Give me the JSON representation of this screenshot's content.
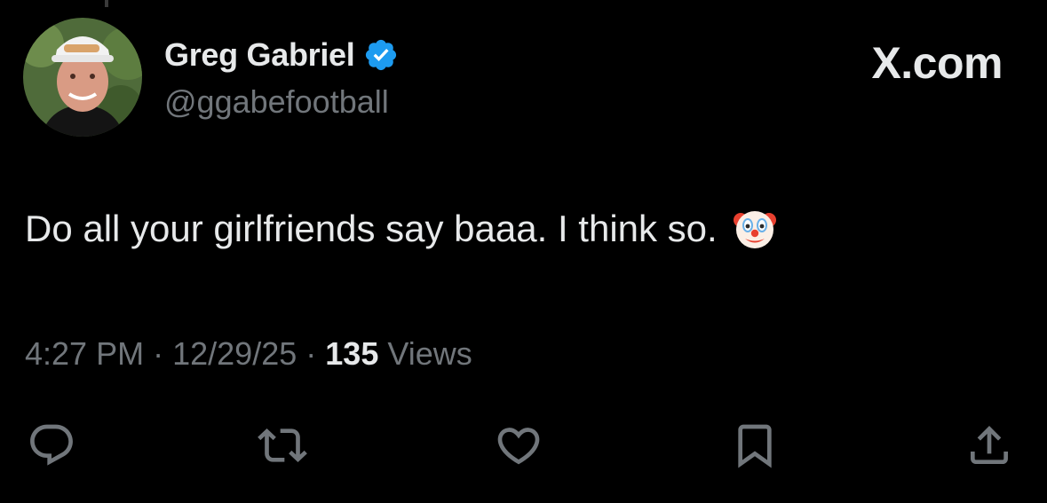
{
  "author": {
    "display_name": "Greg Gabriel",
    "handle": "@ggabefootball",
    "verified_badge_icon": "verified-check-icon",
    "verified_color": "#1d9bf0"
  },
  "brand": {
    "text": "X.com"
  },
  "tweet": {
    "text": "Do all your girlfriends say baaa. I think so.",
    "emoji_icon": "clown-face-emoji"
  },
  "meta": {
    "time": "4:27 PM",
    "separator": "·",
    "date": "12/29/25",
    "views_count": "135",
    "views_label": "Views"
  },
  "actions": [
    {
      "name": "reply",
      "icon": "reply-icon"
    },
    {
      "name": "retweet",
      "icon": "retweet-icon"
    },
    {
      "name": "like",
      "icon": "heart-icon"
    },
    {
      "name": "bookmark",
      "icon": "bookmark-icon"
    },
    {
      "name": "share",
      "icon": "share-icon"
    }
  ],
  "colors": {
    "background": "#000000",
    "primary_text": "#e7e9ea",
    "secondary_text": "#71767b",
    "icon": "#71767b",
    "accent": "#1d9bf0"
  }
}
